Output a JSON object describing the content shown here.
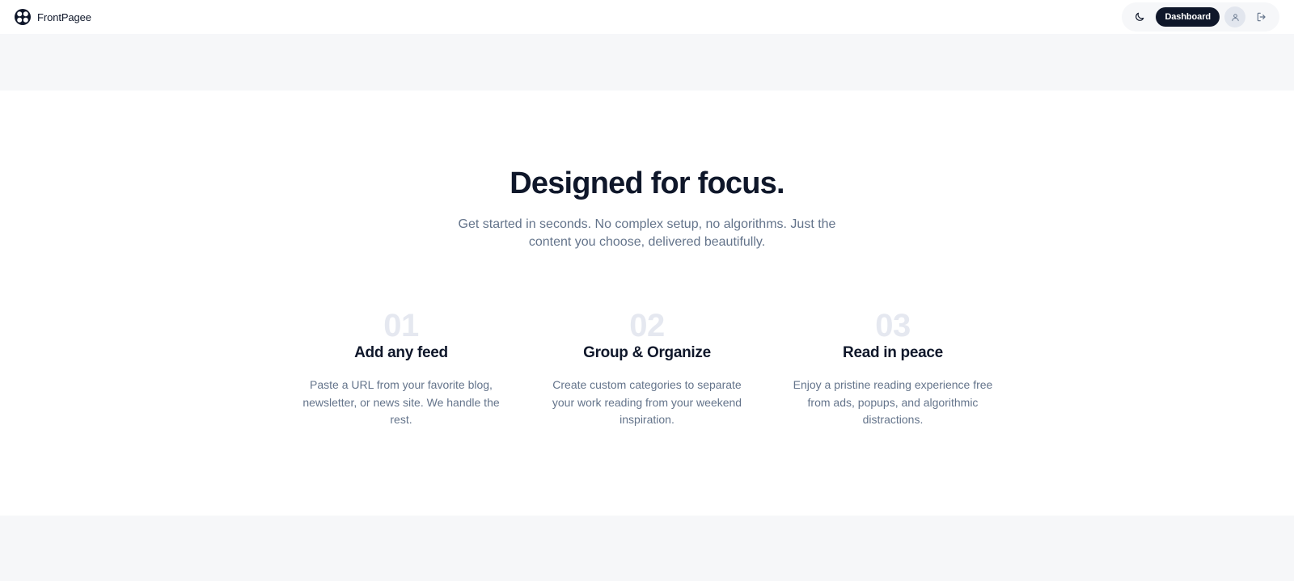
{
  "app": {
    "brand_name": "FrontPagee",
    "logo_icon": "frontpagee-logo-icon"
  },
  "header": {
    "theme_toggle_icon": "moon-icon",
    "dashboard_label": "Dashboard",
    "avatar_icon": "user-icon",
    "logout_icon": "logout-icon"
  },
  "features": {
    "title": "Designed for focus.",
    "subtitle": "Get started in seconds. No complex setup, no algorithms. Just the content you choose, delivered beautifully.",
    "steps": [
      {
        "number": "01",
        "title": "Add any feed",
        "description": "Paste a URL from your favorite blog, newsletter, or news site. We handle the rest."
      },
      {
        "number": "02",
        "title": "Group & Organize",
        "description": "Create custom categories to separate your work reading from your weekend inspiration."
      },
      {
        "number": "03",
        "title": "Read in peace",
        "description": "Enjoy a pristine reading experience free from ads, popups, and algorithmic distractions."
      }
    ]
  },
  "colors": {
    "primary": "#0f172a",
    "muted_text": "#64748b",
    "step_number": "#e5e8f0",
    "band_background": "#f6f7f9",
    "surface": "#ffffff"
  }
}
